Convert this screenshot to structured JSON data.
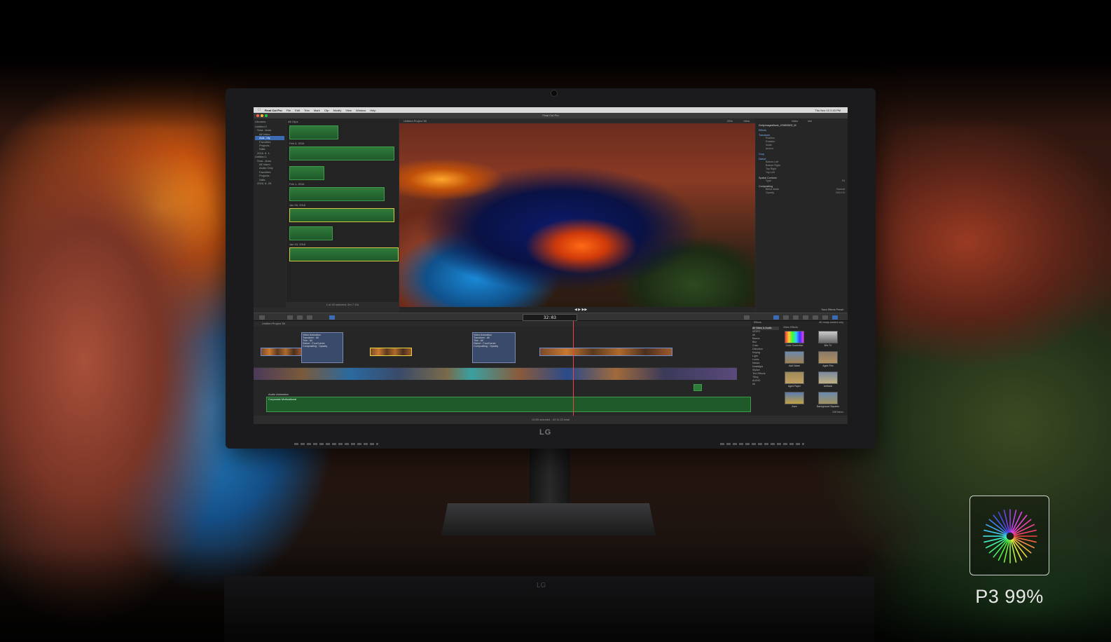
{
  "app": {
    "title": "Final Cut Pro",
    "menu": [
      "Final Cut Pro",
      "File",
      "Edit",
      "Trim",
      "Mark",
      "Clip",
      "Modify",
      "View",
      "Window",
      "Help"
    ],
    "clock": "Thu Nov 10 2:43 PM"
  },
  "libraries": {
    "header": "Libraries",
    "items": [
      "Untitled 2",
      "Sma...tions",
      "All Video",
      "Aud...nly",
      "Favorites",
      "Projects",
      "Stills",
      "2016. 6. 1.",
      "Untitled 1",
      "Sma...tions",
      "All Video",
      "Audio Only",
      "Favorites",
      "Projects",
      "Stills",
      "2016. 6. 25."
    ]
  },
  "browser": {
    "header": "All Clips",
    "groups": [
      "Feb 3, 2016",
      "Feb 1, 2016",
      "Jan 30, 2016",
      "Jan 15, 2016"
    ],
    "status": "1 of 42 selected, 3m 7.11s"
  },
  "viewer": {
    "project": "Untitled Project 38",
    "zoom": "25%",
    "view": "View"
  },
  "inspector": {
    "tabs": [
      "Video",
      "Info"
    ],
    "clip_name": "GettyImagesBank_476853502_M",
    "sections": {
      "effects": "Effects",
      "transform": "Transform",
      "position": "Position",
      "rotation": "Rotation",
      "scale": "Scale",
      "anchor": "Anchor",
      "crop": "Crop",
      "distort": "Distort",
      "bottom_left": "Bottom Left",
      "bottom_right": "Bottom Right",
      "top_right": "Top Right",
      "top_left": "Top Left",
      "spatial_conform": "Spatial Conform",
      "type": "Type",
      "type_value": "Fit",
      "compositing": "Compositing",
      "blend_mode": "Blend Mode",
      "blend_value": "Normal",
      "opacity": "Opacity",
      "opacity_value": "100.0 %"
    },
    "save": "Save Effects Preset"
  },
  "toolbar": {
    "timecode": "32:03"
  },
  "timeline": {
    "project": "Untitled Project 38",
    "clips": {
      "video_animation_1": "Video Animation",
      "video_animation_2": "Video Animation",
      "transform_all": "Transform : All",
      "trim_all": "Trim : All",
      "distort": "Distort : FourCorner",
      "compositing": "Compositing : Opacity"
    },
    "audio_label": "Audio Animation",
    "audio_clip": "Corporate Motivational",
    "status": "04:09 selected - 02:11:22 total"
  },
  "effects": {
    "header": "Effects",
    "filter": "4K-ready content only",
    "all": "All Video & Audio",
    "title": "Video Effects",
    "categories": [
      "VIDEO",
      "All",
      "Basics",
      "Blur",
      "Color",
      "Distortion",
      "Keying",
      "Light",
      "Looks",
      "Masks",
      "Nostalgia",
      "Stylize",
      "Text Effects",
      "Tiling",
      "AUDIO",
      "All"
    ],
    "items": [
      "Color Correction",
      "50s TV",
      "Add Noise",
      "Aged Film",
      "Aged Paper",
      "Artifacts",
      "Aura",
      "Background Squares"
    ],
    "count": "228 Items"
  },
  "brand": {
    "logo": "LG"
  },
  "badge": {
    "label": "P3 99%",
    "icon": "color-gamut-icon"
  },
  "colors": {
    "accent_blue": "#3d6bb3",
    "clip_green": "#2f7a3a",
    "playhead_red": "#e44444"
  }
}
